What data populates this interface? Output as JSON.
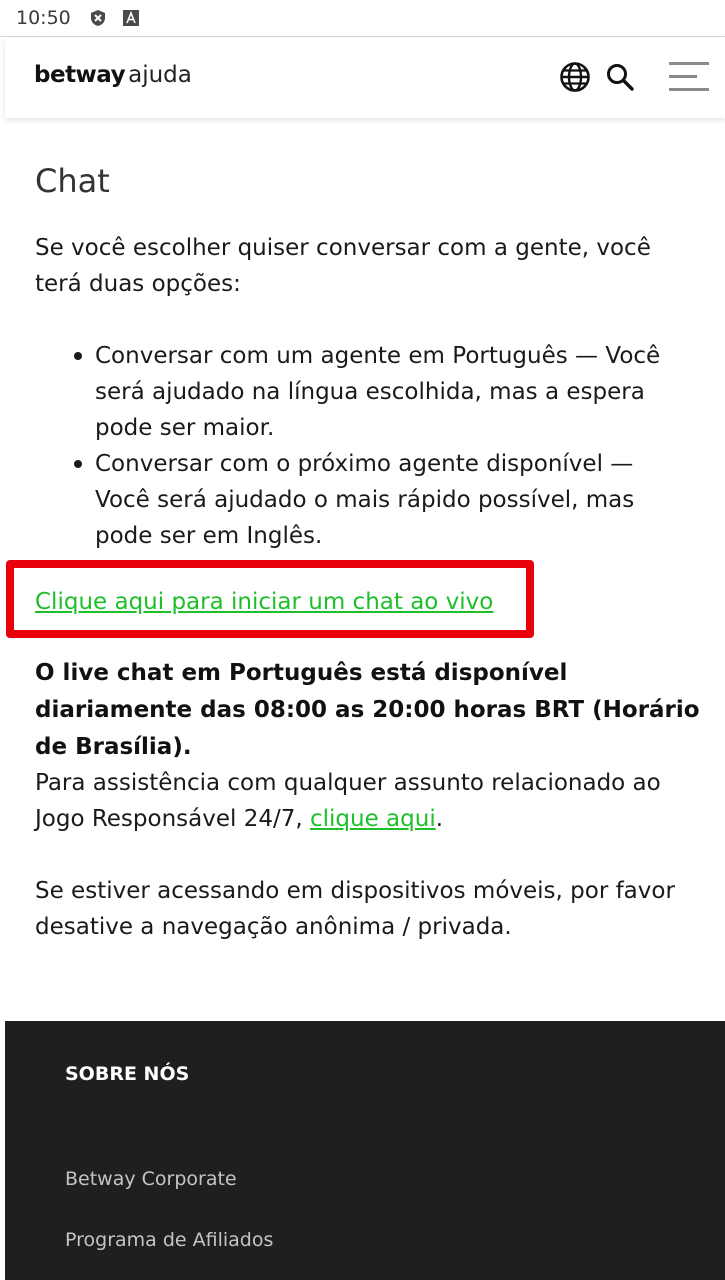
{
  "status_bar": {
    "time": "10:50",
    "icons": [
      "shield-x-icon",
      "font-a-icon"
    ]
  },
  "header": {
    "brand": "betway",
    "brand_sub": "ajuda",
    "icons": [
      "globe-icon",
      "search-icon",
      "menu-icon"
    ]
  },
  "main": {
    "title": "Chat",
    "intro": "Se você escolher quiser conversar com a gente, você terá duas opções:",
    "options": [
      "Conversar com um agente em Português — Você será ajudado na língua escolhida, mas a espera pode ser maior.",
      "Conversar com o próximo agente disponível — Você será ajudado o mais rápido possível, mas pode ser em Inglês."
    ],
    "chat_link": "Clique aqui para iniciar um chat ao vivo",
    "hours_notice": "O live chat em Português está disponível diariamente das 08:00 as 20:00 horas BRT (Horário de Brasília).",
    "responsible_prefix": "Para assistência com qualquer assunto relacionado ao Jogo Responsável 24/7, ",
    "responsible_link": "clique aqui",
    "responsible_suffix": ".",
    "mobile_notice": "Se estiver acessando em dispositivos móveis, por favor desative a navegação anônima / privada."
  },
  "footer": {
    "heading": "SOBRE NÓS",
    "links": [
      "Betway Corporate",
      "Programa de Afiliados"
    ]
  },
  "colors": {
    "link": "#1fbf2a",
    "highlight_box": "#e8000b",
    "footer_bg": "#1f1f1f"
  }
}
